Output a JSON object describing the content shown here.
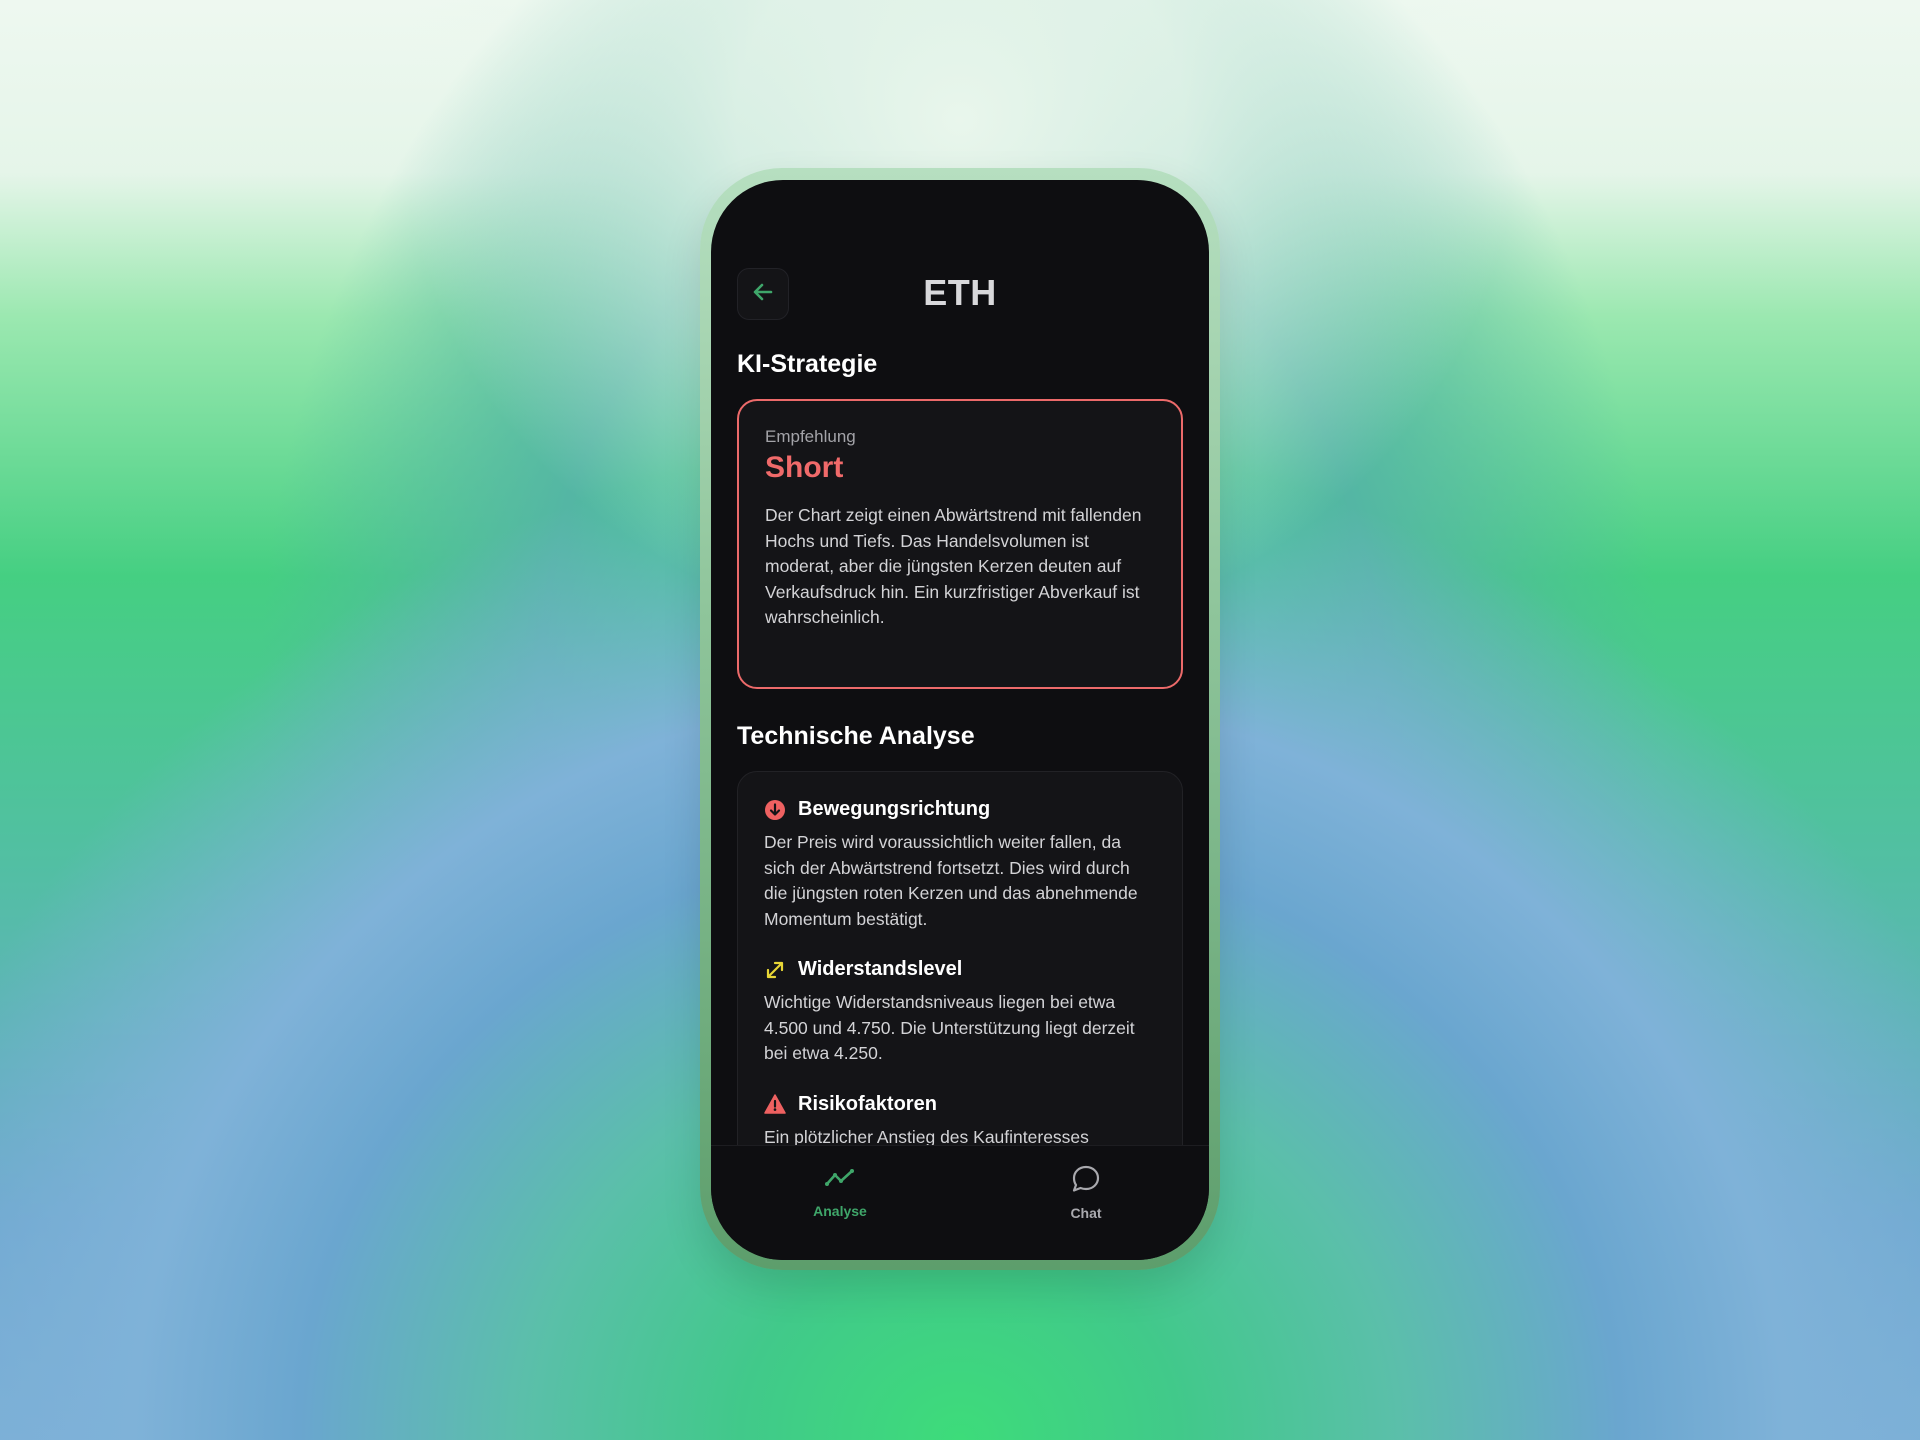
{
  "header": {
    "title": "ETH",
    "back_icon": "arrow-left-icon"
  },
  "strategy": {
    "section_title": "KI-Strategie",
    "label": "Empfehlung",
    "value": "Short",
    "description": "Der Chart zeigt einen Abwärtstrend mit fallenden Hochs und Tiefs. Das Handelsvolumen ist moderat, aber die jüngsten Kerzen deuten auf Verkaufsdruck hin. Ein kurzfristiger Abverkauf ist wahrscheinlich.",
    "accent_color": "#f06a6a"
  },
  "analysis": {
    "section_title": "Technische Analyse",
    "items": [
      {
        "icon": "arrow-down-circle-icon",
        "title": "Bewegungsrichtung",
        "text": "Der Preis wird voraussichtlich weiter fallen, da sich der Abwärtstrend fortsetzt. Dies wird durch die jüngsten roten Kerzen und das abnehmende Momentum bestätigt."
      },
      {
        "icon": "expand-arrows-icon",
        "title": "Widerstandslevel",
        "text": "Wichtige Widerstandsniveaus liegen bei etwa 4.500 und 4.750. Die Unterstützung liegt derzeit bei etwa 4.250."
      },
      {
        "icon": "warning-triangle-icon",
        "title": "Risikofaktoren",
        "text": "Ein plötzlicher Anstieg des Kaufinteresses"
      }
    ]
  },
  "tabbar": {
    "tabs": [
      {
        "label": "Analyse",
        "icon": "trend-line-icon",
        "active": true
      },
      {
        "label": "Chat",
        "icon": "chat-bubble-icon",
        "active": false
      }
    ],
    "active_color": "#3fa66a",
    "inactive_color": "#a9a9ae"
  }
}
